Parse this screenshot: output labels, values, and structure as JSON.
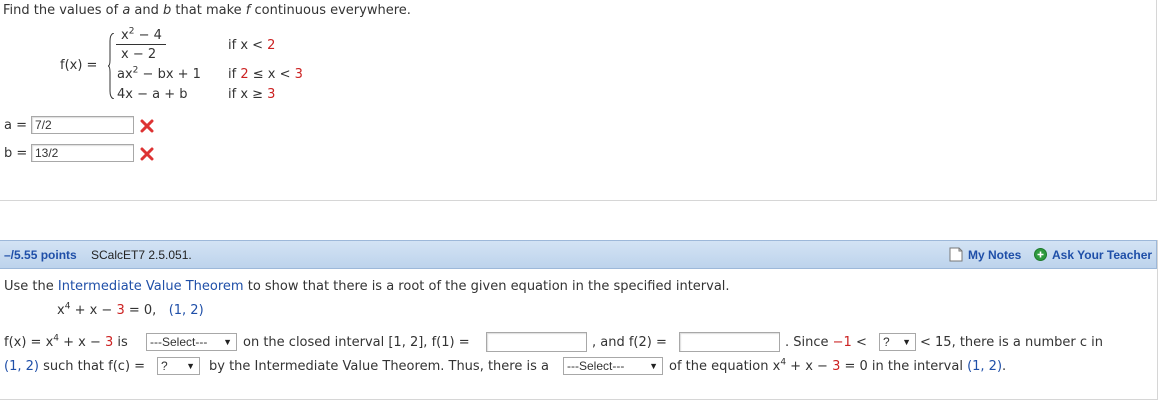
{
  "problem1": {
    "prompt": {
      "p1": "Find the values of ",
      "a": "a",
      "p2": " and ",
      "b": "b",
      "p3": " that make ",
      "f": "f",
      "p4": " continuous everywhere."
    },
    "fx_label": "f(x) =",
    "piece1": {
      "num_x": "x",
      "num_exp": "2",
      "num_rest": " − 4",
      "den": "x − 2",
      "cond_if": "if x < ",
      "cond_val": "2"
    },
    "piece2": {
      "a": "ax",
      "exp": "2",
      "rest": " − bx + 1",
      "cond_if": "if ",
      "cond_2": "2",
      "cond_mid": " ≤ x < ",
      "cond_3": "3"
    },
    "piece3": {
      "expr": "4x − a + b",
      "cond_if": "if x ≥ ",
      "cond_val": "3"
    },
    "answers": [
      {
        "label": "a =",
        "value": "7/2",
        "status_icon": "x-icon"
      },
      {
        "label": "b =",
        "value": "13/2",
        "status_icon": "x-icon"
      }
    ]
  },
  "problem2": {
    "header": {
      "points": "–/5.55 points",
      "code": "SCalcET7 2.5.051.",
      "my_notes": "My Notes",
      "ask_teacher": "Ask Your Teacher"
    },
    "prompt": {
      "p1": "Use the ",
      "link": "Intermediate Value Theorem",
      "p2": " to show that there is a root of the given equation in the specified interval."
    },
    "equation": {
      "x": "x",
      "exp": "4",
      "rest1": " + x − ",
      "three": "3",
      "eq": " = 0,",
      "interval": "(1, 2)"
    },
    "line1": {
      "fx": "f(x) = x",
      "exp": "4",
      "rest": " + x − ",
      "three": "3",
      "is": " is",
      "select1": "---Select---",
      "closed": "on the closed interval [1, 2],",
      "f1": "f(1) =",
      "and_f2": ", and f(2) =",
      "since": ". Since ",
      "neg1": "−1",
      "lt": " <",
      "select2": "?",
      "lt2": " < 15, there is a number c in"
    },
    "line2": {
      "interval": "(1, 2)",
      "such": " such that f(c) =",
      "select3": "?",
      "by": "by the Intermediate Value Theorem. Thus, there is a",
      "select4": "---Select---",
      "of": "of the equation x",
      "exp": "4",
      "rest": " + x − ",
      "three": "3",
      "zero": " = 0",
      "in": " in the interval ",
      "interval2": "(1, 2)",
      "end": "."
    }
  },
  "colors": {
    "red": "#cc2222",
    "link_blue": "#1f4fa8",
    "header_bg": "#c6daf0"
  }
}
